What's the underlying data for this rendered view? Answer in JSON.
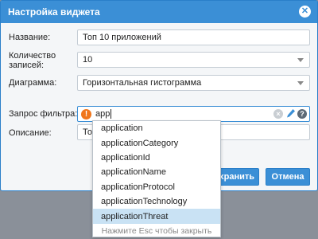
{
  "dialog": {
    "title": "Настройка виджета",
    "close_glyph": "✕"
  },
  "form": {
    "name_label": "Название:",
    "name_value": "Топ 10 приложений",
    "count_label_line1": "Количество",
    "count_label_line2": "записей:",
    "count_value": "10",
    "chart_label": "Диаграмма:",
    "chart_value": "Горизонтальная гистограмма",
    "filter_label": "Запрос фильтра:",
    "filter_value": "app",
    "description_label": "Описание:",
    "description_value": "Топ"
  },
  "icons": {
    "warning": "warning-icon",
    "clear": "clear-icon",
    "edit": "pencil-icon",
    "help": "help-icon",
    "warning_glyph": "!",
    "clear_glyph": "×",
    "help_glyph": "?"
  },
  "buttons": {
    "save_label": "хранить",
    "cancel_label": "Отмена"
  },
  "autocomplete": {
    "items": [
      "application",
      "applicationCategory",
      "applicationId",
      "applicationName",
      "applicationProtocol",
      "applicationTechnology",
      "applicationThreat"
    ],
    "selected_index": 6,
    "hint": "Нажмите Esc чтобы закрыть"
  },
  "colors": {
    "accent": "#3b8fd6",
    "warning": "#f0761b",
    "selected_row": "#c9e2f4"
  }
}
